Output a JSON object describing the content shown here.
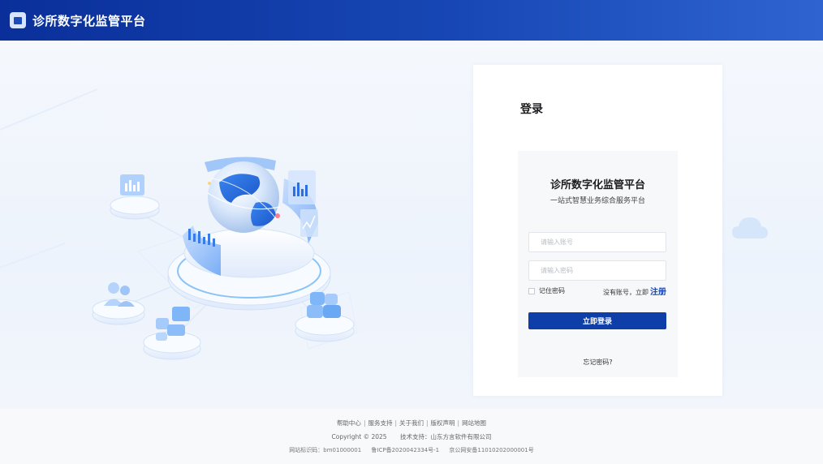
{
  "header": {
    "title": "诊所数字化监管平台",
    "logo_icon": "app-logo-icon"
  },
  "login": {
    "heading": "登录",
    "panel_title": "诊所数字化监管平台",
    "panel_subtitle": "一站式智慧业务综合服务平台",
    "account_placeholder": "请输入账号",
    "password_placeholder": "请输入密码",
    "remember_label": "记住密码",
    "no_account_text": "没有账号，立即",
    "register_label": "注册",
    "submit_label": "立即登录",
    "forgot_label": "忘记密码?"
  },
  "footer": {
    "links": [
      "帮助中心",
      "服务支持",
      "关于我们",
      "版权声明",
      "网站地图"
    ],
    "copyright": "Copyright © 2025",
    "tech_support": "技术支持：山东方言软件有限公司",
    "site_code": "网站标识码：bm01000001",
    "icp": "鲁ICP备2020042334号-1",
    "police": "京公网安备11010202000001号"
  },
  "colors": {
    "header_start": "#0a2f9a",
    "header_end": "#2f64d0",
    "primary": "#0e3ea8",
    "link": "#1747b4"
  }
}
